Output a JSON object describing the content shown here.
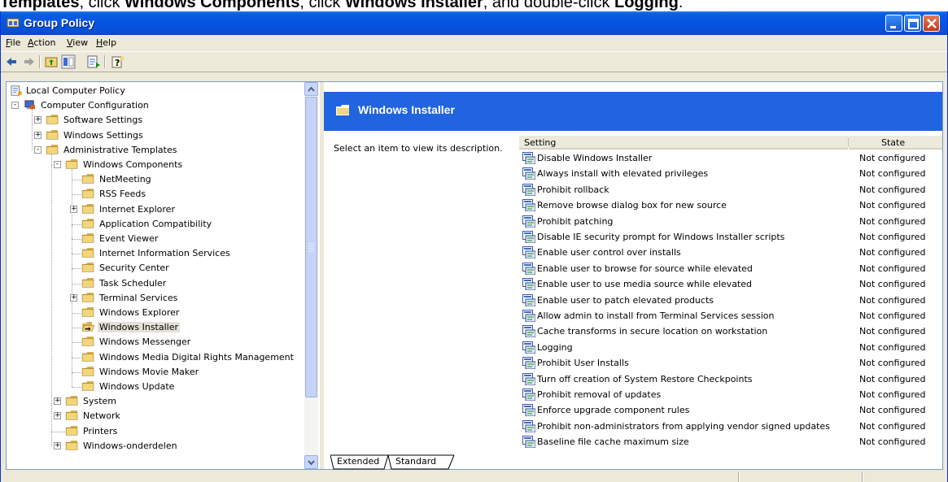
{
  "instruction": {
    "prefix": "Templates",
    "text1": ", click ",
    "bold1": "Windows Components",
    "text2": ", click ",
    "bold2": "Windows Installer",
    "text3": ", and double-click ",
    "bold3": "Logging",
    "text4": "."
  },
  "window": {
    "title": "Group Policy"
  },
  "menu": [
    "File",
    "Action",
    "View",
    "Help"
  ],
  "toolbar": [
    "back-icon",
    "forward-icon",
    "up-folder-icon",
    "show-hide-tree-icon",
    "export-list-icon",
    "help-icon"
  ],
  "tree": [
    {
      "label": "Local Computer Policy",
      "icon": "policy-icon"
    },
    {
      "label": "Computer Configuration",
      "icon": "computer-icon"
    },
    {
      "label": "Software Settings"
    },
    {
      "label": "Windows Settings"
    },
    {
      "label": "Administrative Templates"
    },
    {
      "label": "Windows Components"
    },
    {
      "label": "NetMeeting"
    },
    {
      "label": "RSS Feeds"
    },
    {
      "label": "Internet Explorer"
    },
    {
      "label": "Application Compatibility"
    },
    {
      "label": "Event Viewer"
    },
    {
      "label": "Internet Information Services"
    },
    {
      "label": "Security Center"
    },
    {
      "label": "Task Scheduler"
    },
    {
      "label": "Terminal Services"
    },
    {
      "label": "Windows Explorer"
    },
    {
      "label": "Windows Installer",
      "selected": true
    },
    {
      "label": "Windows Messenger"
    },
    {
      "label": "Windows Media Digital Rights Management"
    },
    {
      "label": "Windows Movie Maker"
    },
    {
      "label": "Windows Update"
    },
    {
      "label": "System"
    },
    {
      "label": "Network"
    },
    {
      "label": "Printers"
    },
    {
      "label": "Windows-onderdelen"
    }
  ],
  "right_pane": {
    "title": "Windows Installer",
    "description": "Select an item to view its description.",
    "columns": [
      "Setting",
      "State"
    ],
    "rows": [
      {
        "setting": "Disable Windows Installer",
        "state": "Not configured"
      },
      {
        "setting": "Always install with elevated privileges",
        "state": "Not configured"
      },
      {
        "setting": "Prohibit rollback",
        "state": "Not configured"
      },
      {
        "setting": "Remove browse dialog box for new source",
        "state": "Not configured"
      },
      {
        "setting": "Prohibit patching",
        "state": "Not configured"
      },
      {
        "setting": "Disable IE security prompt for Windows Installer scripts",
        "state": "Not configured"
      },
      {
        "setting": "Enable user control over installs",
        "state": "Not configured"
      },
      {
        "setting": "Enable user to browse for source while elevated",
        "state": "Not configured"
      },
      {
        "setting": "Enable user to use media source while elevated",
        "state": "Not configured"
      },
      {
        "setting": "Enable user to patch elevated products",
        "state": "Not configured"
      },
      {
        "setting": "Allow admin to install from Terminal Services session",
        "state": "Not configured"
      },
      {
        "setting": "Cache transforms in secure location on workstation",
        "state": "Not configured"
      },
      {
        "setting": "Logging",
        "state": "Not configured"
      },
      {
        "setting": "Prohibit User Installs",
        "state": "Not configured"
      },
      {
        "setting": "Turn off creation of System Restore Checkpoints",
        "state": "Not configured"
      },
      {
        "setting": "Prohibit removal of updates",
        "state": "Not configured"
      },
      {
        "setting": "Enforce upgrade component rules",
        "state": "Not configured"
      },
      {
        "setting": "Prohibit non-administrators from applying vendor signed updates",
        "state": "Not configured"
      },
      {
        "setting": "Baseline file cache maximum size",
        "state": "Not configured"
      }
    ],
    "tabs": [
      "Extended",
      "Standard"
    ]
  },
  "colors": {
    "title_bar": "#0554e3",
    "banner": "#2164df",
    "folder": "#f3d57a",
    "window_bg": "#ece9d8"
  }
}
